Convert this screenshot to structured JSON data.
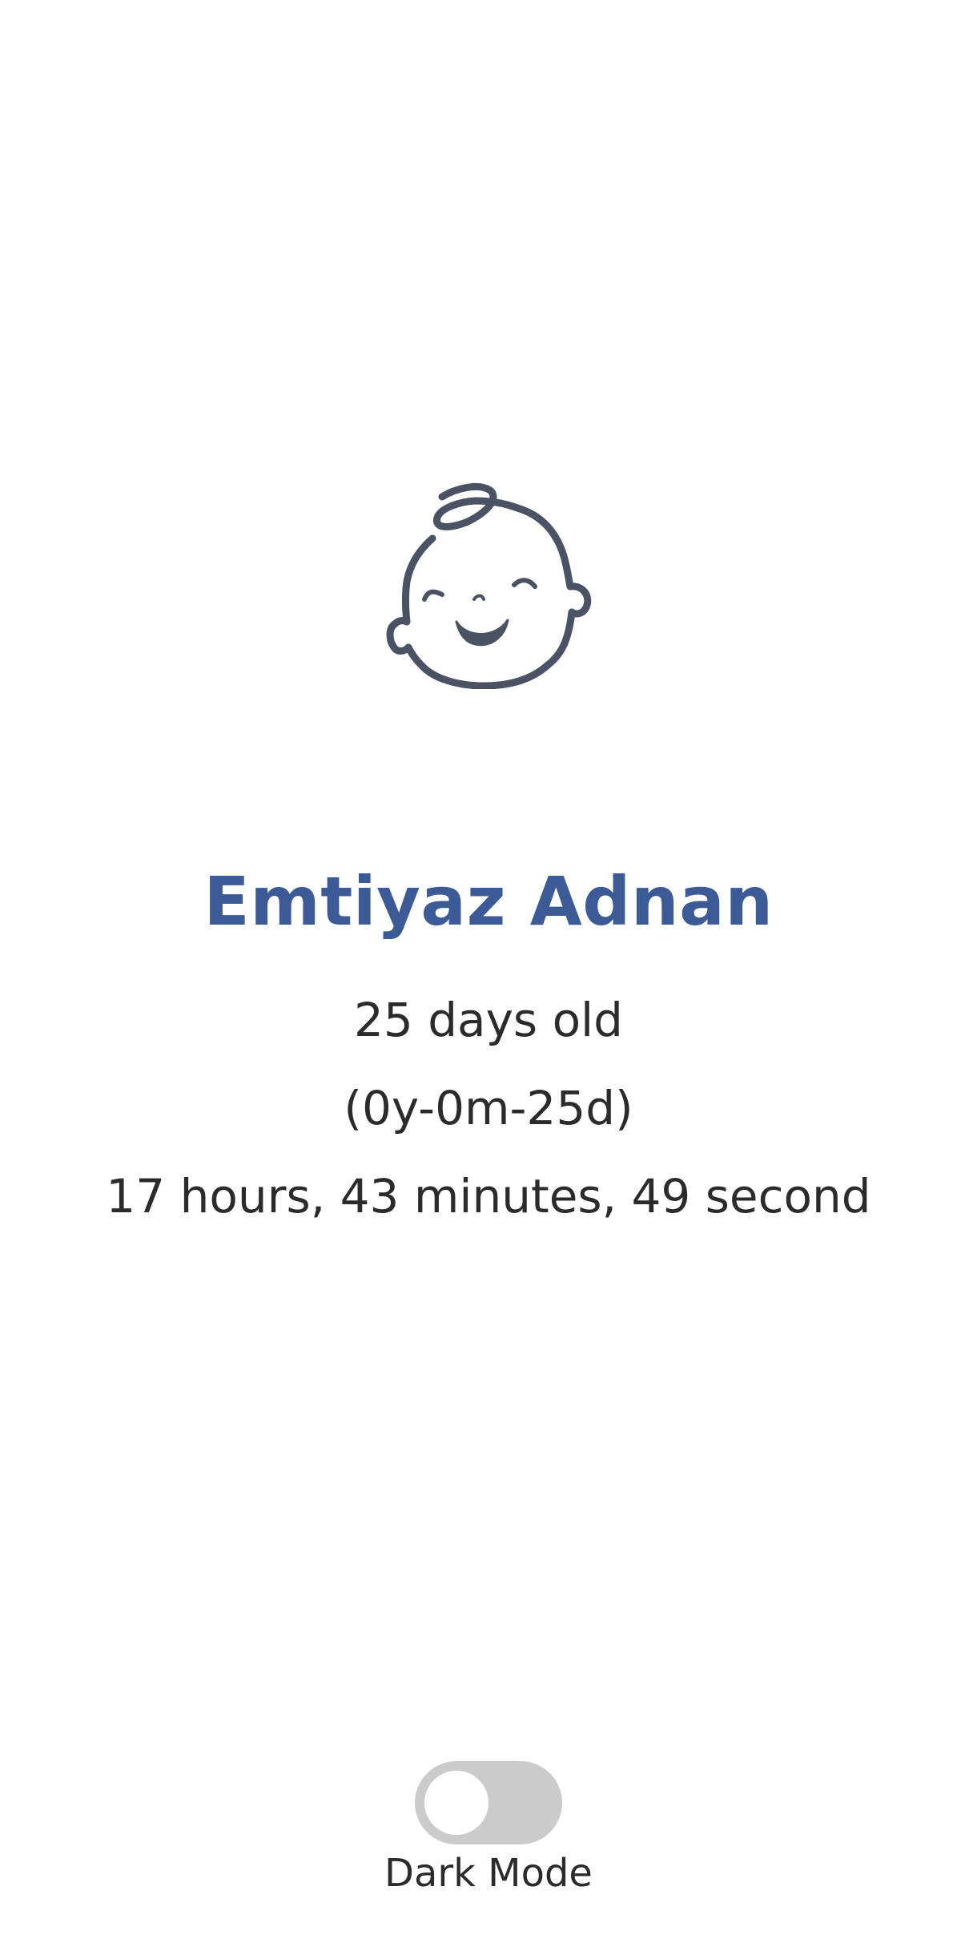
{
  "icon": "baby-face-icon",
  "profile": {
    "name": "Emtiyaz Adnan",
    "age_days": "25 days old",
    "age_ymd": "(0y-0m-25d)",
    "age_time": "17 hours, 43 minutes, 49 second"
  },
  "settings": {
    "dark_mode_label": "Dark Mode",
    "dark_mode_on": false
  },
  "colors": {
    "name": "#3c5a96",
    "text": "#2b2b2b",
    "icon_stroke": "#4a5263",
    "toggle_track_off": "#cbcbcb",
    "toggle_knob": "#ffffff",
    "background": "#ffffff"
  }
}
